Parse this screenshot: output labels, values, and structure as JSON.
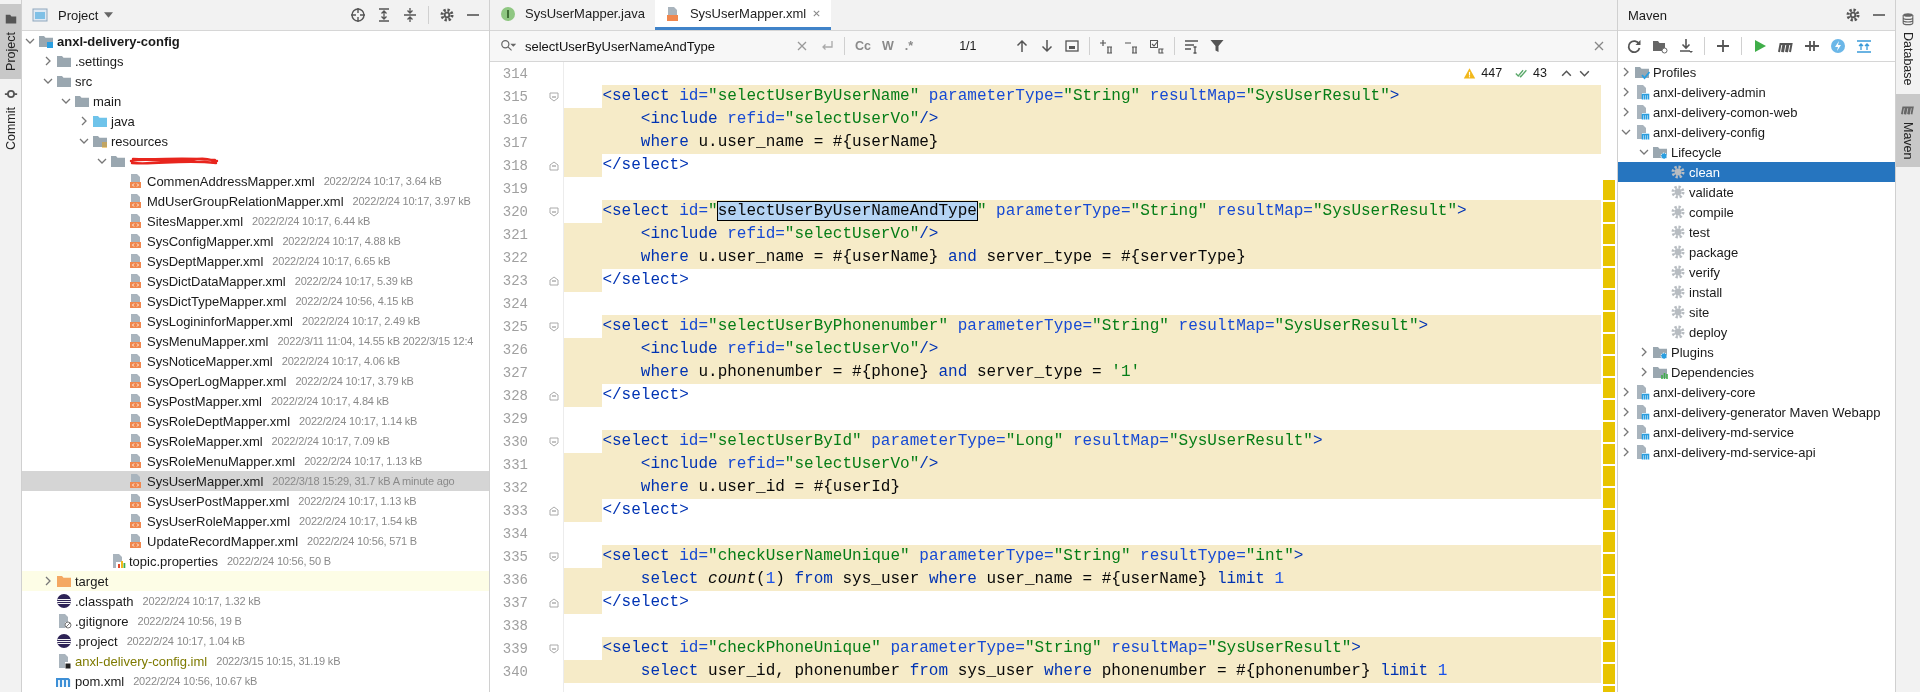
{
  "left_stripe": [
    {
      "label": "Project",
      "kind": "project",
      "selected": true
    },
    {
      "label": "Commit",
      "kind": "commit",
      "selected": false
    }
  ],
  "project_panel": {
    "title": "Project",
    "tree": [
      {
        "name": "anxl-delivery-config",
        "kind": "module",
        "expanded": true,
        "selected": false,
        "children": [
          {
            "name": ".settings",
            "kind": "folder",
            "expanded": false,
            "selected": false
          },
          {
            "name": "src",
            "kind": "folder",
            "expanded": true,
            "selected": false,
            "children": [
              {
                "name": "main",
                "kind": "folder",
                "expanded": true,
                "selected": false,
                "children": [
                  {
                    "name": "java",
                    "kind": "source-folder",
                    "expanded": false,
                    "selected": false
                  },
                  {
                    "name": "resources",
                    "kind": "resource-folder",
                    "expanded": true,
                    "selected": false,
                    "children": [
                      {
                        "kind": "redacted-folder",
                        "expanded": true,
                        "selected": false,
                        "children": [
                          {
                            "name": "CommenAddressMapper.xml",
                            "meta": "2022/2/24 10:17, 3.64 kB",
                            "kind": "xml",
                            "selected": false
                          },
                          {
                            "name": "MdUserGroupRelationMapper.xml",
                            "meta": "2022/2/24 10:17, 3.97 kB",
                            "kind": "xml",
                            "selected": false
                          },
                          {
                            "name": "SitesMapper.xml",
                            "meta": "2022/2/24 10:17, 6.44 kB",
                            "kind": "xml",
                            "selected": false
                          },
                          {
                            "name": "SysConfigMapper.xml",
                            "meta": "2022/2/24 10:17, 4.88 kB",
                            "kind": "xml",
                            "selected": false
                          },
                          {
                            "name": "SysDeptMapper.xml",
                            "meta": "2022/2/24 10:17, 6.65 kB",
                            "kind": "xml",
                            "selected": false
                          },
                          {
                            "name": "SysDictDataMapper.xml",
                            "meta": "2022/2/24 10:17, 5.39 kB",
                            "kind": "xml",
                            "selected": false
                          },
                          {
                            "name": "SysDictTypeMapper.xml",
                            "meta": "2022/2/24 10:56, 4.15 kB",
                            "kind": "xml",
                            "selected": false
                          },
                          {
                            "name": "SysLogininforMapper.xml",
                            "meta": "2022/2/24 10:17, 2.49 kB",
                            "kind": "xml",
                            "selected": false
                          },
                          {
                            "name": "SysMenuMapper.xml",
                            "meta": "2022/3/11 11:04, 14.55 kB 2022/3/15 12:4",
                            "kind": "xml",
                            "selected": false
                          },
                          {
                            "name": "SysNoticeMapper.xml",
                            "meta": "2022/2/24 10:17, 4.06 kB",
                            "kind": "xml",
                            "selected": false
                          },
                          {
                            "name": "SysOperLogMapper.xml",
                            "meta": "2022/2/24 10:17, 3.79 kB",
                            "kind": "xml",
                            "selected": false
                          },
                          {
                            "name": "SysPostMapper.xml",
                            "meta": "2022/2/24 10:17, 4.84 kB",
                            "kind": "xml",
                            "selected": false
                          },
                          {
                            "name": "SysRoleDeptMapper.xml",
                            "meta": "2022/2/24 10:17, 1.14 kB",
                            "kind": "xml",
                            "selected": false
                          },
                          {
                            "name": "SysRoleMapper.xml",
                            "meta": "2022/2/24 10:17, 7.09 kB",
                            "kind": "xml",
                            "selected": false
                          },
                          {
                            "name": "SysRoleMenuMapper.xml",
                            "meta": "2022/2/24 10:17, 1.13 kB",
                            "kind": "xml",
                            "selected": false
                          },
                          {
                            "name": "SysUserMapper.xml",
                            "meta": "2022/3/18 15:29, 31.7 kB A minute ago",
                            "kind": "xml",
                            "selected": true
                          },
                          {
                            "name": "SysUserPostMapper.xml",
                            "meta": "2022/2/24 10:17, 1.13 kB",
                            "kind": "xml",
                            "selected": false
                          },
                          {
                            "name": "SysUserRoleMapper.xml",
                            "meta": "2022/2/24 10:17, 1.54 kB",
                            "kind": "xml",
                            "selected": false
                          },
                          {
                            "name": "UpdateRecordMapper.xml",
                            "meta": "2022/2/24 10:56, 571 B",
                            "kind": "xml",
                            "selected": false
                          }
                        ]
                      },
                      {
                        "name": "topic.properties",
                        "meta": "2022/2/24 10:56, 50 B",
                        "kind": "properties",
                        "selected": false
                      }
                    ]
                  }
                ]
              }
            ]
          },
          {
            "name": "target",
            "kind": "excluded-folder",
            "expanded": false,
            "selected": false
          },
          {
            "name": ".classpath",
            "meta": "2022/2/24 10:17, 1.32 kB",
            "kind": "eclipse",
            "selected": false
          },
          {
            "name": ".gitignore",
            "meta": "2022/2/24 10:56, 19 B",
            "kind": "gitignore",
            "selected": false
          },
          {
            "name": ".project",
            "meta": "2022/2/24 10:17, 1.04 kB",
            "kind": "eclipse",
            "selected": false
          },
          {
            "name": "anxl-delivery-config.iml",
            "meta": "2022/3/15 10:15, 31.19 kB",
            "kind": "iml",
            "selected": false
          },
          {
            "name": "pom.xml",
            "meta": "2022/2/24 10:56, 10.67 kB",
            "kind": "maven",
            "selected": false
          }
        ]
      }
    ]
  },
  "editor": {
    "tabs": [
      {
        "label": "SysUserMapper.java",
        "kind": "java",
        "selected": false
      },
      {
        "label": "SysUserMapper.xml",
        "kind": "xml",
        "selected": true
      }
    ],
    "find": {
      "value": "selectUserByUserNameAndType",
      "options": [
        "Cc",
        "W",
        ".*"
      ],
      "count": "1/1"
    },
    "inspections": {
      "warnings": "447",
      "weak_warnings": "43"
    },
    "lines": [
      {
        "number": "314",
        "kind": "plain"
      },
      {
        "number": "315",
        "kind": "open",
        "tokens": [
          {
            "kind": "tag",
            "text": "<select"
          },
          {
            "kind": "attr",
            "text": " id="
          },
          {
            "kind": "str",
            "text": "\"selectUserByUserName\""
          },
          {
            "kind": "attr",
            "text": " parameterType="
          },
          {
            "kind": "str",
            "text": "\"String\""
          },
          {
            "kind": "attr",
            "text": " resultMap="
          },
          {
            "kind": "str",
            "text": "\"SysUserResult\""
          },
          {
            "kind": "tag",
            "text": ">"
          }
        ]
      },
      {
        "number": "316",
        "kind": "body",
        "tokens": [
          {
            "kind": "tag",
            "text": "<include"
          },
          {
            "kind": "attr",
            "text": " refid="
          },
          {
            "kind": "str",
            "text": "\"selectUserVo\""
          },
          {
            "kind": "tag",
            "text": "/>"
          }
        ]
      },
      {
        "number": "317",
        "kind": "body",
        "tokens": [
          {
            "kind": "kw",
            "text": "where"
          },
          {
            "kind": "text",
            "text": " u.user_name = #{userName}"
          }
        ]
      },
      {
        "number": "318",
        "kind": "close",
        "tokens": [
          {
            "kind": "tag",
            "text": "</select>"
          }
        ]
      },
      {
        "number": "319",
        "kind": "plain"
      },
      {
        "number": "320",
        "kind": "open",
        "tokens": [
          {
            "kind": "tag",
            "text": "<select"
          },
          {
            "kind": "attr",
            "text": " id="
          },
          {
            "kind": "str",
            "text": "\""
          },
          {
            "kind": "match",
            "text": "selectUserByUserNameAndType"
          },
          {
            "kind": "str",
            "text": "\""
          },
          {
            "kind": "attr",
            "text": " parameterType="
          },
          {
            "kind": "str",
            "text": "\"String\""
          },
          {
            "kind": "attr",
            "text": " resultMap="
          },
          {
            "kind": "str",
            "text": "\"SysUserResult\""
          },
          {
            "kind": "tag",
            "text": ">"
          }
        ]
      },
      {
        "number": "321",
        "kind": "body",
        "tokens": [
          {
            "kind": "tag",
            "text": "<include"
          },
          {
            "kind": "attr",
            "text": " refid="
          },
          {
            "kind": "str",
            "text": "\"selectUserVo\""
          },
          {
            "kind": "tag",
            "text": "/>"
          }
        ]
      },
      {
        "number": "322",
        "kind": "body",
        "tokens": [
          {
            "kind": "kw",
            "text": "where"
          },
          {
            "kind": "text",
            "text": " u.user_name = #{userName} "
          },
          {
            "kind": "kw",
            "text": "and"
          },
          {
            "kind": "text",
            "text": " server_type = #{serverType}"
          }
        ]
      },
      {
        "number": "323",
        "kind": "close",
        "tokens": [
          {
            "kind": "tag",
            "text": "</select>"
          }
        ]
      },
      {
        "number": "324",
        "kind": "plain"
      },
      {
        "number": "325",
        "kind": "open",
        "tokens": [
          {
            "kind": "tag",
            "text": "<select"
          },
          {
            "kind": "attr",
            "text": " id="
          },
          {
            "kind": "str",
            "text": "\"selectUserByPhonenumber\""
          },
          {
            "kind": "attr",
            "text": " parameterType="
          },
          {
            "kind": "str",
            "text": "\"String\""
          },
          {
            "kind": "attr",
            "text": " resultMap="
          },
          {
            "kind": "str",
            "text": "\"SysUserResult\""
          },
          {
            "kind": "tag",
            "text": ">"
          }
        ]
      },
      {
        "number": "326",
        "kind": "body",
        "tokens": [
          {
            "kind": "tag",
            "text": "<include"
          },
          {
            "kind": "attr",
            "text": " refid="
          },
          {
            "kind": "str",
            "text": "\"selectUserVo\""
          },
          {
            "kind": "tag",
            "text": "/>"
          }
        ]
      },
      {
        "number": "327",
        "kind": "body",
        "tokens": [
          {
            "kind": "kw",
            "text": "where"
          },
          {
            "kind": "text",
            "text": " u.phonenumber = #{phone} "
          },
          {
            "kind": "kw",
            "text": "and"
          },
          {
            "kind": "text",
            "text": " server_type = "
          },
          {
            "kind": "str",
            "text": "'1'"
          }
        ]
      },
      {
        "number": "328",
        "kind": "close",
        "tokens": [
          {
            "kind": "tag",
            "text": "</select>"
          }
        ]
      },
      {
        "number": "329",
        "kind": "plain"
      },
      {
        "number": "330",
        "kind": "open",
        "tokens": [
          {
            "kind": "tag",
            "text": "<select"
          },
          {
            "kind": "attr",
            "text": " id="
          },
          {
            "kind": "str",
            "text": "\"selectUserById\""
          },
          {
            "kind": "attr",
            "text": " parameterType="
          },
          {
            "kind": "str",
            "text": "\"Long\""
          },
          {
            "kind": "attr",
            "text": " resultMap="
          },
          {
            "kind": "str",
            "text": "\"SysUserResult\""
          },
          {
            "kind": "tag",
            "text": ">"
          }
        ]
      },
      {
        "number": "331",
        "kind": "body",
        "tokens": [
          {
            "kind": "tag",
            "text": "<include"
          },
          {
            "kind": "attr",
            "text": " refid="
          },
          {
            "kind": "str",
            "text": "\"selectUserVo\""
          },
          {
            "kind": "tag",
            "text": "/>"
          }
        ]
      },
      {
        "number": "332",
        "kind": "body",
        "tokens": [
          {
            "kind": "kw",
            "text": "where"
          },
          {
            "kind": "text",
            "text": " u.user_id = #{userId}"
          }
        ]
      },
      {
        "number": "333",
        "kind": "close",
        "tokens": [
          {
            "kind": "tag",
            "text": "</select>"
          }
        ]
      },
      {
        "number": "334",
        "kind": "plain"
      },
      {
        "number": "335",
        "kind": "open",
        "tokens": [
          {
            "kind": "tag",
            "text": "<select"
          },
          {
            "kind": "attr",
            "text": " id="
          },
          {
            "kind": "str",
            "text": "\"checkUserNameUnique\""
          },
          {
            "kind": "attr",
            "text": " parameterType="
          },
          {
            "kind": "str",
            "text": "\"String\""
          },
          {
            "kind": "attr",
            "text": " resultType="
          },
          {
            "kind": "str",
            "text": "\"int\""
          },
          {
            "kind": "tag",
            "text": ">"
          }
        ]
      },
      {
        "number": "336",
        "kind": "body",
        "tokens": [
          {
            "kind": "kw",
            "text": "select "
          },
          {
            "kind": "fn",
            "text": "count"
          },
          {
            "kind": "text",
            "text": "("
          },
          {
            "kind": "num",
            "text": "1"
          },
          {
            "kind": "text",
            "text": ") "
          },
          {
            "kind": "kw",
            "text": "from"
          },
          {
            "kind": "text",
            "text": " sys_user "
          },
          {
            "kind": "kw",
            "text": "where"
          },
          {
            "kind": "text",
            "text": " user_name = #{userName} "
          },
          {
            "kind": "kw",
            "text": "limit "
          },
          {
            "kind": "num",
            "text": "1"
          }
        ]
      },
      {
        "number": "337",
        "kind": "close",
        "tokens": [
          {
            "kind": "tag",
            "text": "</select>"
          }
        ]
      },
      {
        "number": "338",
        "kind": "plain"
      },
      {
        "number": "339",
        "kind": "open",
        "tokens": [
          {
            "kind": "tag",
            "text": "<select"
          },
          {
            "kind": "attr",
            "text": " id="
          },
          {
            "kind": "str",
            "text": "\"checkPhoneUnique\""
          },
          {
            "kind": "attr",
            "text": " parameterType="
          },
          {
            "kind": "str",
            "text": "\"String\""
          },
          {
            "kind": "attr",
            "text": " resultMap="
          },
          {
            "kind": "str",
            "text": "\"SysUserResult\""
          },
          {
            "kind": "tag",
            "text": ">"
          }
        ]
      },
      {
        "number": "340",
        "kind": "body",
        "tokens": [
          {
            "kind": "kw",
            "text": "select"
          },
          {
            "kind": "text",
            "text": " user_id, phonenumber "
          },
          {
            "kind": "kw",
            "text": "from"
          },
          {
            "kind": "text",
            "text": " sys_user "
          },
          {
            "kind": "kw",
            "text": "where"
          },
          {
            "kind": "text",
            "text": " phonenumber = #{phonenumber} "
          },
          {
            "kind": "kw",
            "text": "limit "
          },
          {
            "kind": "num",
            "text": "1"
          }
        ]
      }
    ]
  },
  "maven_panel": {
    "title": "Maven",
    "tree": [
      {
        "name": "Profiles",
        "kind": "profiles",
        "expanded": false,
        "selected": false
      },
      {
        "name": "anxl-delivery-admin",
        "kind": "maven-module",
        "expanded": false,
        "selected": false
      },
      {
        "name": "anxl-delivery-comon-web",
        "kind": "maven-module",
        "expanded": false,
        "selected": false
      },
      {
        "name": "anxl-delivery-config",
        "kind": "maven-module",
        "expanded": true,
        "selected": false,
        "children": [
          {
            "name": "Lifecycle",
            "kind": "lifecycle",
            "expanded": true,
            "selected": false,
            "children": [
              {
                "name": "clean",
                "kind": "goal",
                "selected": true
              },
              {
                "name": "validate",
                "kind": "goal",
                "selected": false
              },
              {
                "name": "compile",
                "kind": "goal",
                "selected": false
              },
              {
                "name": "test",
                "kind": "goal",
                "selected": false
              },
              {
                "name": "package",
                "kind": "goal",
                "selected": false
              },
              {
                "name": "verify",
                "kind": "goal",
                "selected": false
              },
              {
                "name": "install",
                "kind": "goal",
                "selected": false
              },
              {
                "name": "site",
                "kind": "goal",
                "selected": false
              },
              {
                "name": "deploy",
                "kind": "goal",
                "selected": false
              }
            ]
          },
          {
            "name": "Plugins",
            "kind": "plugins",
            "expanded": false,
            "selected": false
          },
          {
            "name": "Dependencies",
            "kind": "dependencies",
            "expanded": false,
            "selected": false
          }
        ]
      },
      {
        "name": "anxl-delivery-core",
        "kind": "maven-module",
        "expanded": false,
        "selected": false
      },
      {
        "name": "anxl-delivery-generator Maven Webapp",
        "kind": "maven-module",
        "expanded": false,
        "selected": false
      },
      {
        "name": "anxl-delivery-md-service",
        "kind": "maven-module",
        "expanded": false,
        "selected": false
      },
      {
        "name": "anxl-delivery-md-service-api",
        "kind": "maven-module",
        "expanded": false,
        "selected": false
      }
    ]
  },
  "right_stripe": [
    {
      "label": "Database",
      "kind": "database",
      "selected": false
    },
    {
      "label": "Maven",
      "kind": "maven",
      "selected": true
    }
  ]
}
